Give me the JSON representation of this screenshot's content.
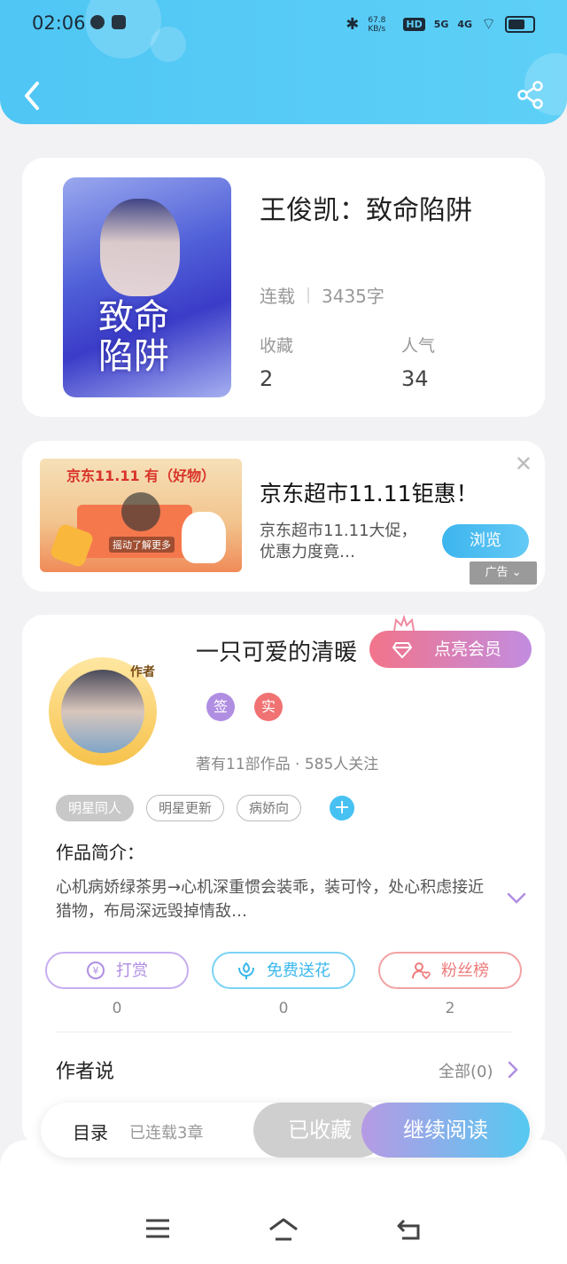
{
  "status_bar": {
    "time": "02:06",
    "net_speed": "67.8 KB/s",
    "hd": "HD",
    "signal1": "5G",
    "signal2": "4G"
  },
  "book": {
    "title": "王俊凯：致命陷阱",
    "cover_title": "致命陷阱",
    "status": "连载",
    "word_count": "3435字",
    "favorites_label": "收藏",
    "favorites_value": "2",
    "popularity_label": "人气",
    "popularity_value": "34"
  },
  "ad": {
    "image_text": "京东11.11 有（好物）",
    "image_hint": "摇动了解更多",
    "title": "京东超市11.11钜惠！",
    "description": "京东超市11.11大促，优惠力度竟…",
    "button_label": "浏览",
    "badge": "广告",
    "close_icon": "close-icon"
  },
  "author": {
    "avatar_tag": "作者",
    "name": "一只可爱的清暖",
    "vip_label": "点亮会员",
    "badge_sign": "签",
    "badge_real": "实",
    "stats": "著有11部作品 · 585人关注",
    "tags": [
      "明星同人",
      "明星更新",
      "病娇向"
    ],
    "intro_label": "作品简介：",
    "intro_text": "心机病娇绿茶男→心机深重惯会装乖，装可怜，处心积虑接近猎物，布局深远毁掉情敌…",
    "actions": {
      "reward_label": "打赏",
      "reward_count": "0",
      "flower_label": "免费送花",
      "flower_count": "0",
      "fans_label": "粉丝榜",
      "fans_count": "2"
    },
    "say_label": "作者说",
    "say_all": "全部(0)"
  },
  "bottom_bar": {
    "menu_label": "目录",
    "serial_info": "已连载3章",
    "favorited_label": "已收藏",
    "continue_label": "继续阅读"
  },
  "colors": {
    "header": "#4fc6f4",
    "accent_blue": "#46c1f2",
    "reward": "#b08ee2",
    "flower": "#46c1f2",
    "fans": "#ee7b7b"
  }
}
